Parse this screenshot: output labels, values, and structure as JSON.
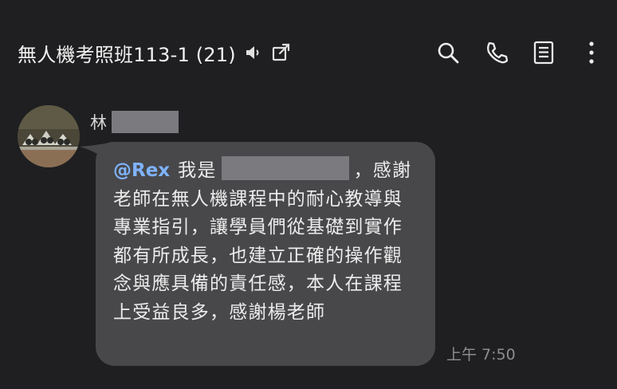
{
  "header": {
    "title": "無人機考照班113-1 (21)",
    "icons": [
      "speaker-icon",
      "external-link-icon",
      "search-icon",
      "phone-icon",
      "notes-icon",
      "more-vertical-icon"
    ]
  },
  "message": {
    "sender": "林",
    "mention": "@Rex",
    "text_before_redaction": "我是",
    "text_after_redaction": "，感謝老師在無人機課程中的耐心教導與專業指引，讓學員們從基礎到實作都有所成長，也建立正確的操作觀念與應具備的責任感，本人在課程上受益良多，感謝楊老師",
    "time": "上午 7:50"
  },
  "colors": {
    "background": "#1f1f21",
    "bubble": "#48484b",
    "mention": "#7fb3ff",
    "redaction": "#7b7b7f",
    "timestamp": "#8d8d90"
  }
}
